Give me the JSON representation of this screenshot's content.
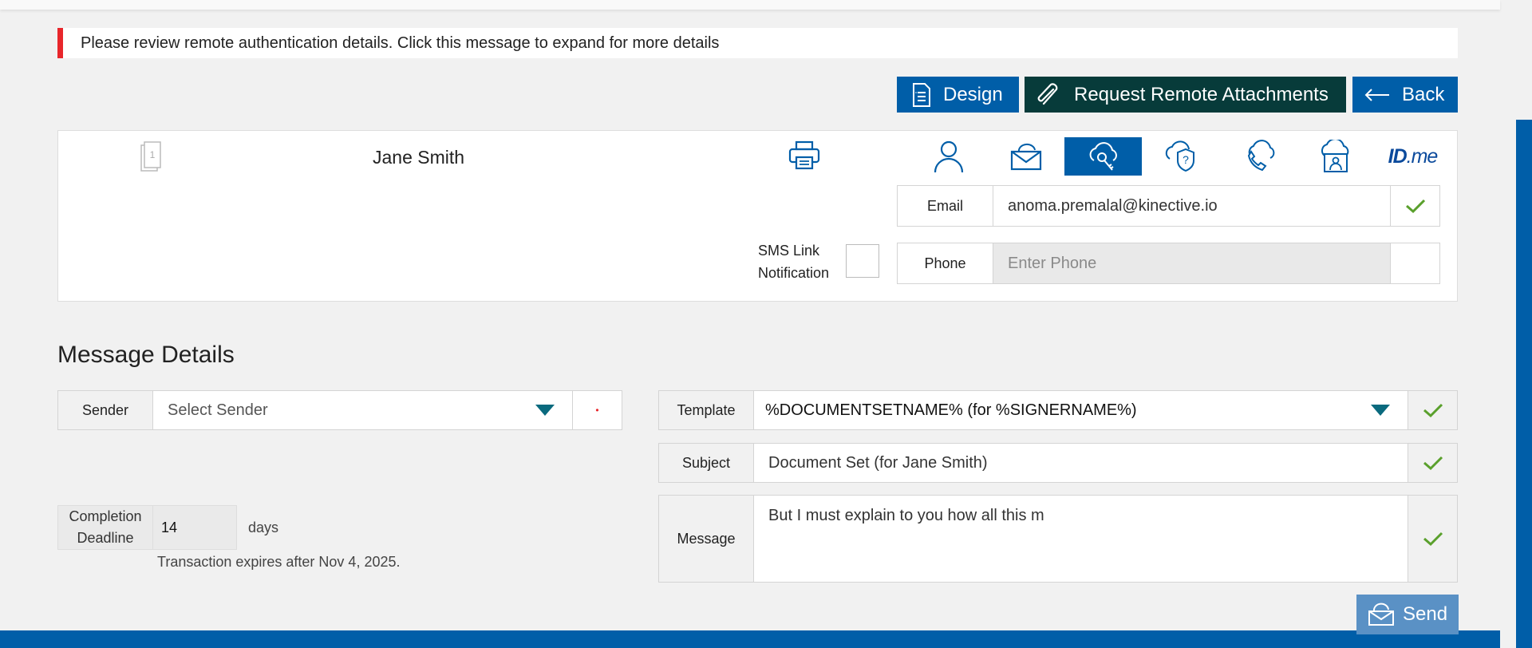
{
  "alert": {
    "text": "Please review remote authentication details. Click this message to expand for more details",
    "accent": "#e8262b"
  },
  "toolbar": {
    "design_label": "Design",
    "request_label": "Request Remote Attachments",
    "back_label": "Back"
  },
  "signer": {
    "doc_count": "1",
    "name": "Jane Smith",
    "auth_methods": [
      "person-icon",
      "email-icon",
      "cloud-key-icon",
      "security-question-icon",
      "phone-icon",
      "id-card-icon",
      "idme-logo"
    ],
    "active_auth": "cloud-key-icon",
    "idme": {
      "id": "ID",
      "me": ".me"
    },
    "email": {
      "label": "Email",
      "value": "anoma.premalal@kinective.io"
    },
    "phone": {
      "label": "Phone",
      "placeholder": "Enter Phone"
    },
    "sms": {
      "line1": "SMS Link",
      "line2": "Notification"
    }
  },
  "message_details": {
    "title": "Message Details",
    "sender": {
      "label": "Sender",
      "placeholder": "Select Sender",
      "required_mark": "•"
    },
    "template": {
      "label": "Template",
      "value": "%DOCUMENTSETNAME% (for %SIGNERNAME%)"
    },
    "subject": {
      "label": "Subject",
      "value": "Document Set (for Jane Smith)"
    },
    "message": {
      "label": "Message",
      "value": "But I must explain to you how all this m"
    },
    "deadline": {
      "line1": "Completion",
      "line2": "Deadline",
      "value": "14",
      "unit": "days"
    },
    "expires": "Transaction expires after Nov 4, 2025.",
    "send_label": "Send"
  },
  "colors": {
    "primary": "#005ea8",
    "dark": "#073b3a",
    "check": "#5aa02c",
    "send": "#5a91c5"
  }
}
